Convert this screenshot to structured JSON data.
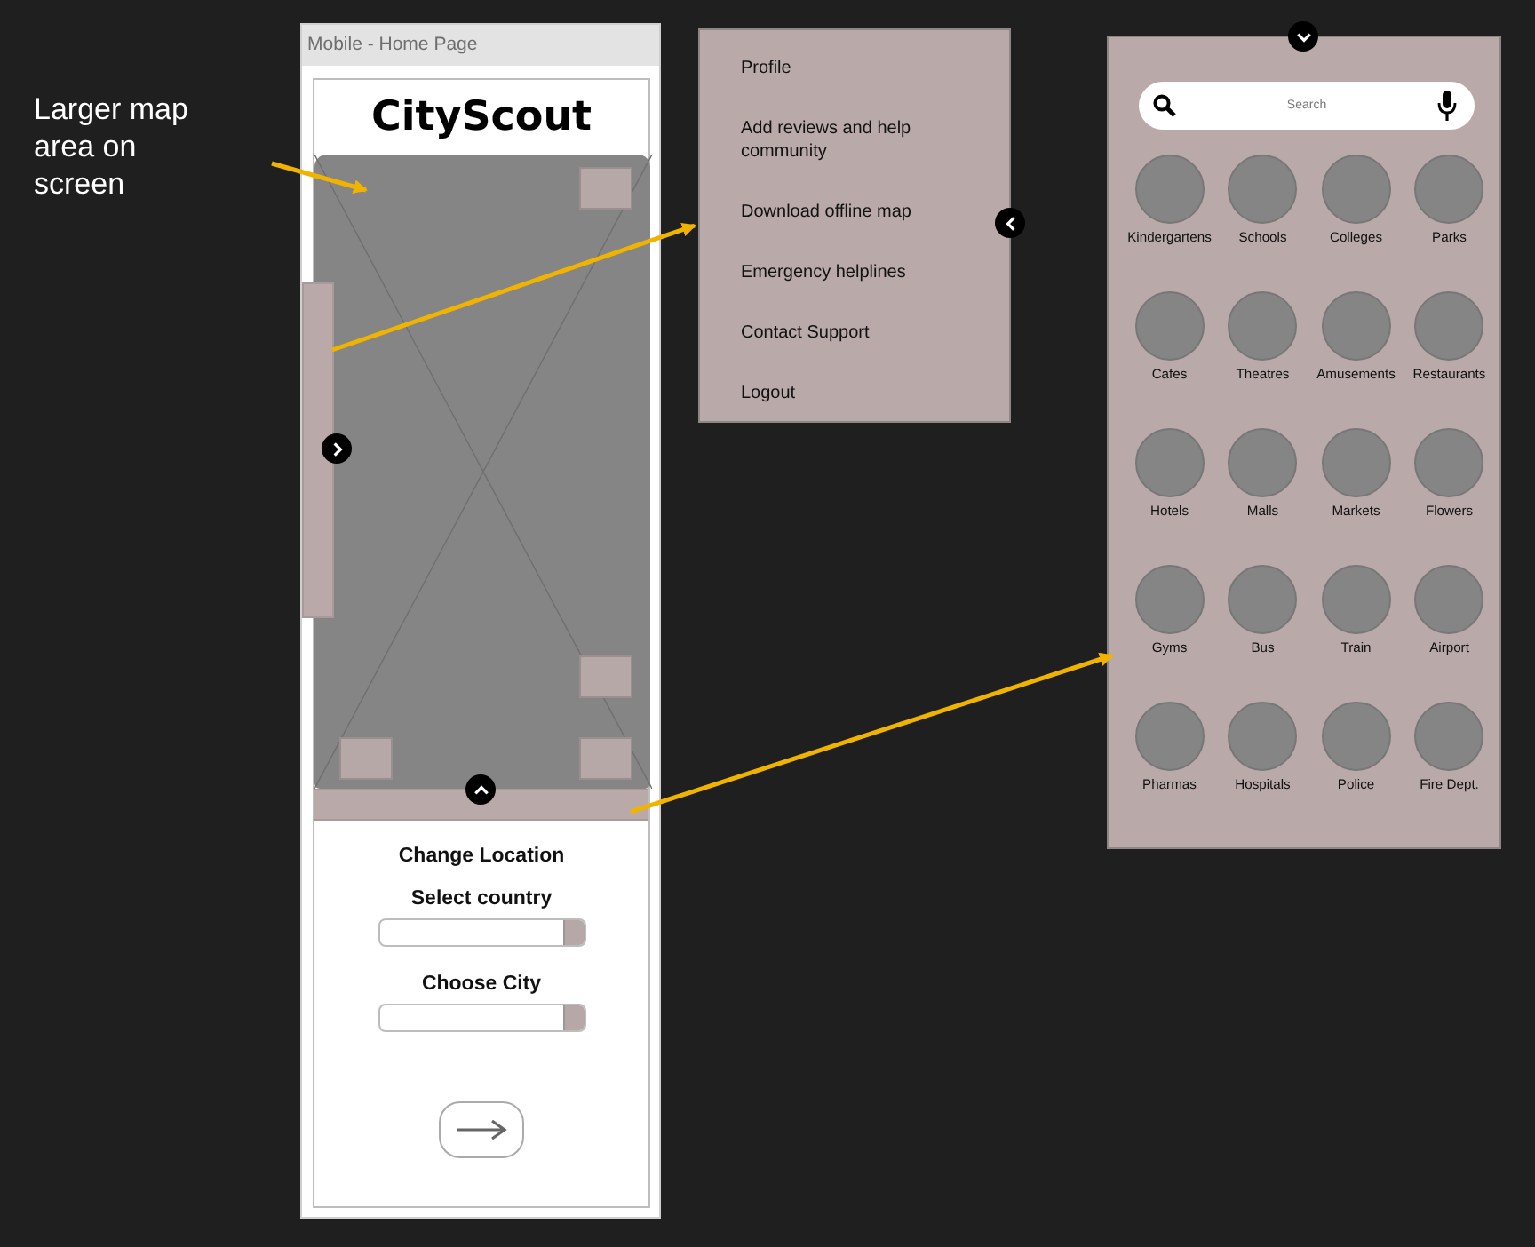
{
  "annotation": {
    "text": "Larger map area on screen"
  },
  "phone": {
    "title": "Mobile - Home Page",
    "app_name": "CityScout",
    "location_heading": "Change Location",
    "fields": [
      {
        "label": "Select country"
      },
      {
        "label": "Choose City"
      }
    ]
  },
  "menu": {
    "items": [
      "Profile",
      "Add reviews and help community",
      "Download offline map",
      "Emergency helplines",
      "Contact Support",
      "Logout"
    ]
  },
  "categories": {
    "search": {
      "placeholder": "Search"
    },
    "items": [
      "Kindergartens",
      "Schools",
      "Colleges",
      "Parks",
      "Cafes",
      "Theatres",
      "Amusements",
      "Restaurants",
      "Hotels",
      "Malls",
      "Markets",
      "Flowers",
      "Gyms",
      "Bus",
      "Train",
      "Airport",
      "Pharmas",
      "Hospitals",
      "Police",
      "Fire Dept."
    ]
  }
}
